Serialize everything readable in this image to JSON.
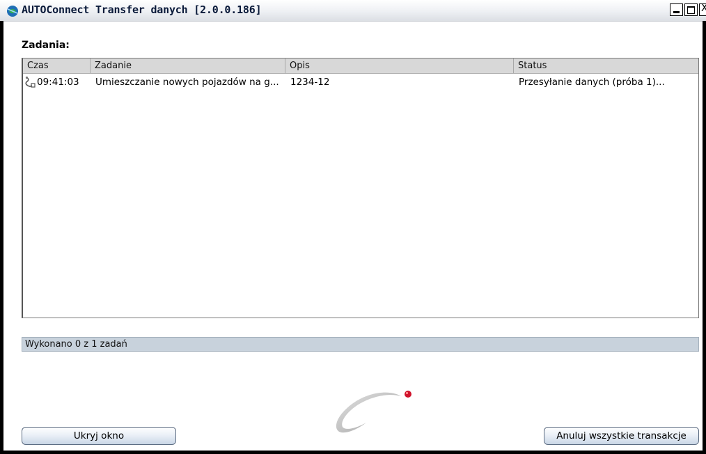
{
  "window": {
    "title": "AUTOConnect Transfer danych [2.0.0.186]",
    "close_glyph": "X"
  },
  "tasks": {
    "label": "Zadania:",
    "columns": [
      "Czas",
      "Zadanie",
      "Opis",
      "Status"
    ],
    "rows": [
      {
        "icon": "transfer-icon",
        "time": "09:41:03",
        "task": "Umieszczanie nowych pojazdów na g...",
        "description": "1234-12",
        "status": "Przesyłanie danych (próba 1)..."
      }
    ]
  },
  "progress": {
    "text": "Wykonano 0 z 1 zadań",
    "done": 0,
    "total": 1
  },
  "buttons": {
    "hide": "Ukryj okno",
    "cancel_all": "Anuluj wszystkie transakcje"
  },
  "colors": {
    "logo_dot": "#d0122b",
    "logo_ring": "#b9b9b9",
    "progress_bg": "#c8d2dc"
  }
}
